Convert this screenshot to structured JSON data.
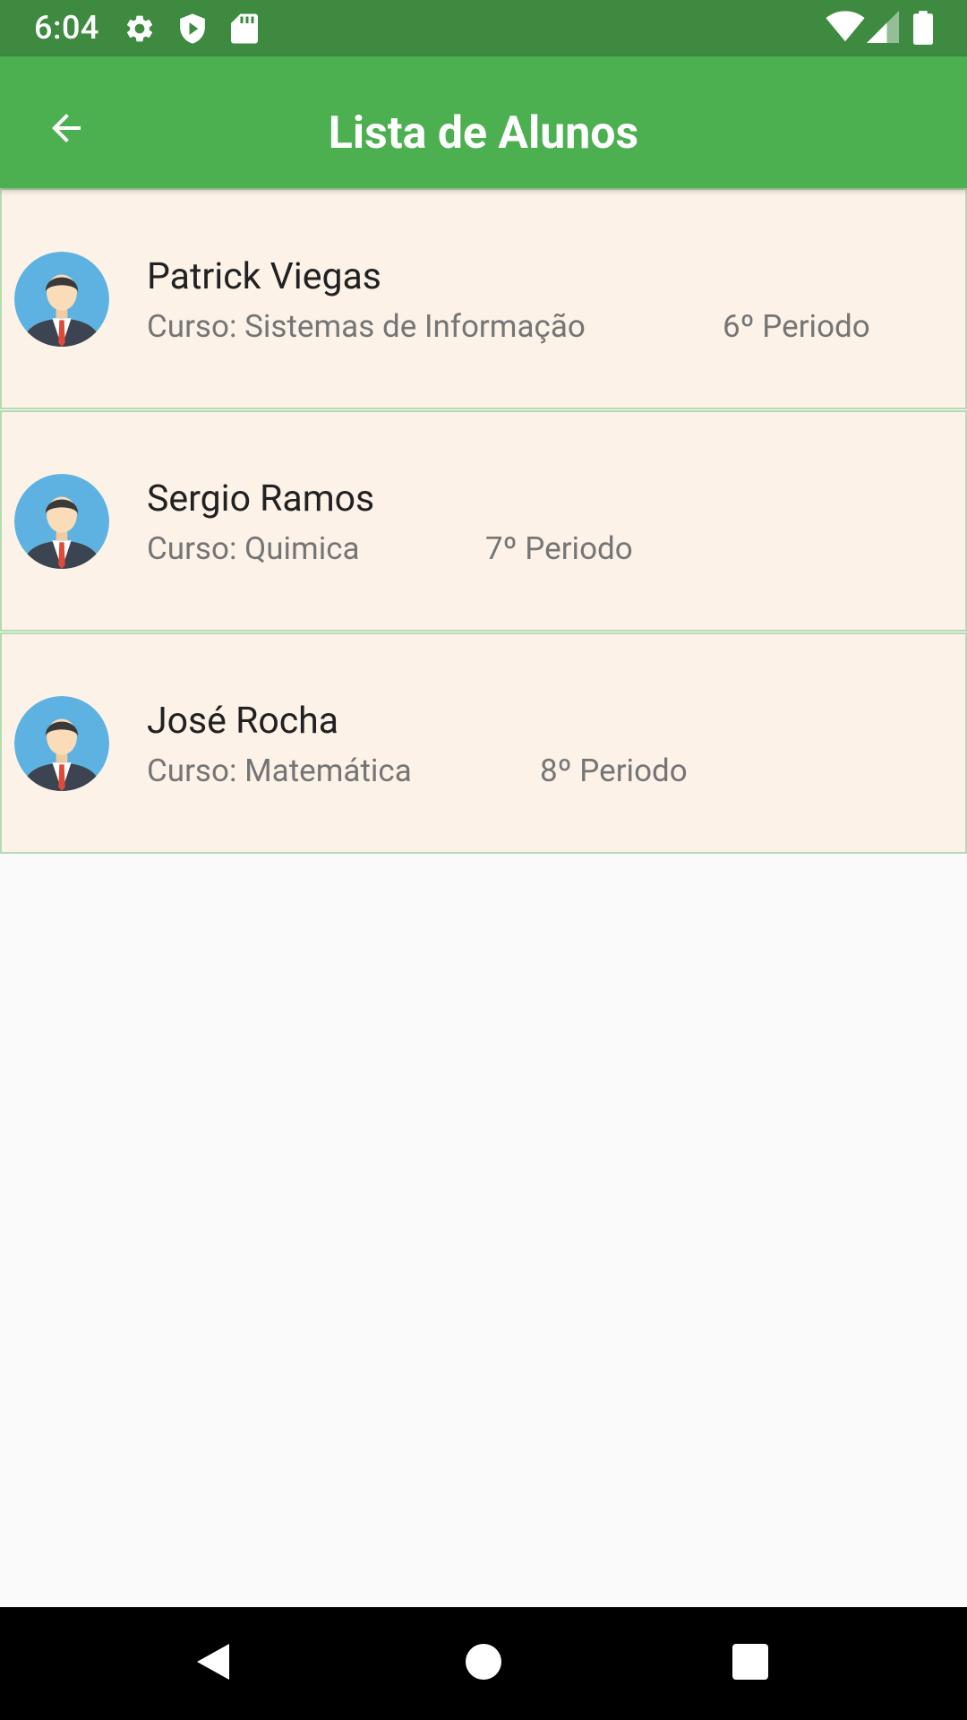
{
  "status_bar": {
    "time": "6:04",
    "icons": [
      "gear-icon",
      "shield-icon",
      "sd-card-icon",
      "wifi-icon",
      "signal-icon",
      "battery-icon"
    ]
  },
  "app_bar": {
    "title": "Lista de Alunos",
    "back_icon": "arrow-left-icon",
    "color": "#4caf50"
  },
  "students": [
    {
      "name": "Patrick Viegas",
      "course": "Curso: Sistemas de Informação",
      "period": "6º Periodo"
    },
    {
      "name": "Sergio Ramos",
      "course": "Curso: Quimica",
      "period": "7º Periodo"
    },
    {
      "name": "José Rocha",
      "course": "Curso: Matemática",
      "period": "8º Periodo"
    }
  ],
  "nav_bar": {
    "buttons": [
      "back-triangle-icon",
      "home-circle-icon",
      "recents-square-icon"
    ]
  }
}
